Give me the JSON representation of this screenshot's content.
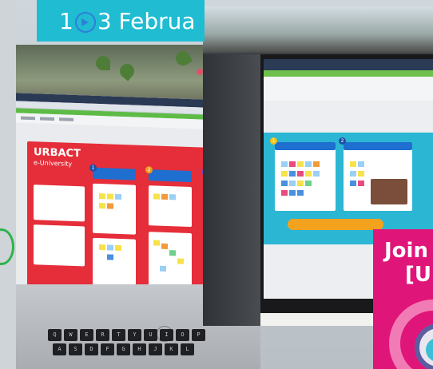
{
  "banner": {
    "prefix": "1",
    "suffix": "3 Februa",
    "icon": "arrow-right-circle-icon"
  },
  "left_photo": {
    "logo_text": "URBACT",
    "logo_sub": "e-University",
    "keys": [
      "Q",
      "W",
      "E",
      "R",
      "T",
      "Y",
      "U",
      "I",
      "O",
      "P",
      "A",
      "S",
      "D",
      "F",
      "G",
      "H",
      "J",
      "K",
      "L"
    ]
  },
  "join_card": {
    "line1": "Join",
    "line2": "[U"
  },
  "colors": {
    "banner": "#1fbcd2",
    "urbact_red": "#e52e3a",
    "board_teal": "#2bb6d3",
    "join_pink": "#e0157a",
    "accent_green": "#2db34a"
  }
}
